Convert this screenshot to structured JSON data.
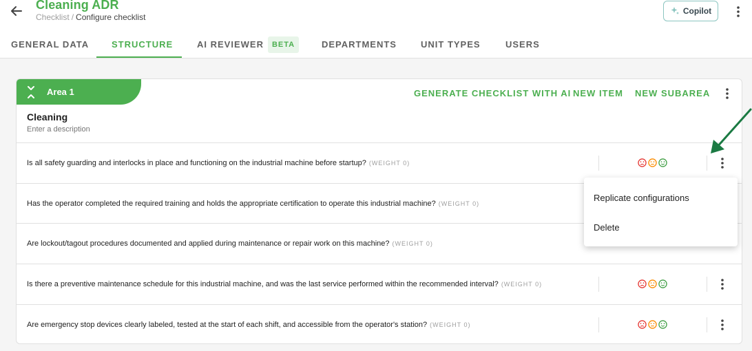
{
  "header": {
    "title": "Cleaning ADR",
    "breadcrumb": {
      "parent": "Checklist",
      "separator": "/",
      "current": "Configure checklist"
    },
    "copilot_label": "Copilot"
  },
  "tabs": [
    {
      "label": "GENERAL DATA"
    },
    {
      "label": "STRUCTURE",
      "active": true
    },
    {
      "label": "AI REVIEWER",
      "badge": "BETA"
    },
    {
      "label": "DEPARTMENTS"
    },
    {
      "label": "UNIT TYPES"
    },
    {
      "label": "USERS"
    }
  ],
  "area": {
    "label": "Area 1",
    "actions": {
      "generate": "GENERATE CHECKLIST WITH AI",
      "new_item": "NEW ITEM",
      "new_subarea": "NEW SUBAREA"
    },
    "section_title": "Cleaning",
    "description_placeholder": "Enter a description"
  },
  "items": [
    {
      "question": "Is all safety guarding and interlocks in place and functioning on the industrial machine before startup?",
      "weight": "(WEIGHT 0)"
    },
    {
      "question": "Has the operator completed the required training and holds the appropriate certification to operate this industrial machine?",
      "weight": "(WEIGHT 0)"
    },
    {
      "question": "Are lockout/tagout procedures documented and applied during maintenance or repair work on this machine?",
      "weight": "(WEIGHT 0)"
    },
    {
      "question": "Is there a preventive maintenance schedule for this industrial machine, and was the last service performed within the recommended interval?",
      "weight": "(WEIGHT 0)"
    },
    {
      "question": "Are emergency stop devices clearly labeled, tested at the start of each shift, and accessible from the operator's station?",
      "weight": "(WEIGHT 0)"
    }
  ],
  "context_menu": {
    "items": [
      "Replicate configurations",
      "Delete"
    ]
  },
  "colors": {
    "brand_green": "#4caf50",
    "face_bad": "#e53935",
    "face_neutral": "#fb8c00",
    "face_good": "#43a047",
    "annotation_arrow": "#1b7a43"
  },
  "icons": [
    "back-arrow-icon",
    "sparkle-icon",
    "kebab-icon",
    "collapse-chevrons-icon",
    "sad-face-icon",
    "neutral-face-icon",
    "happy-face-icon"
  ]
}
